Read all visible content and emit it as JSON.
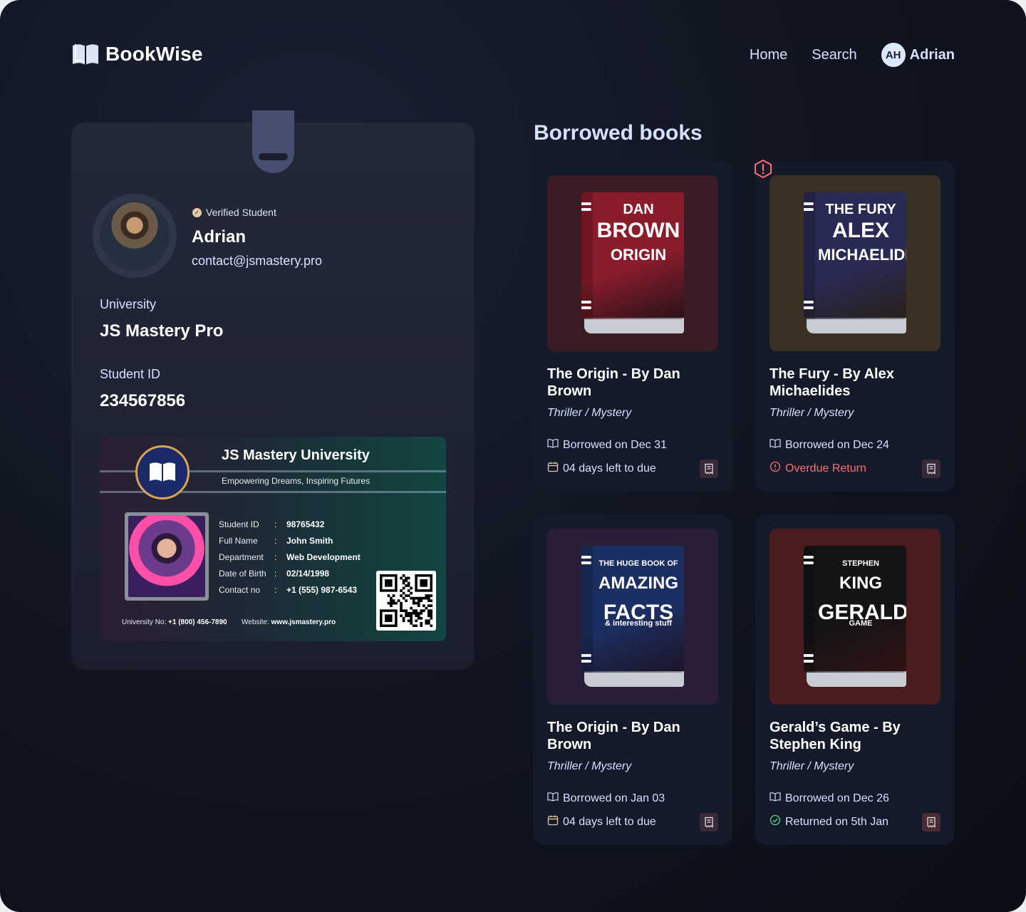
{
  "app": {
    "name": "BookWise"
  },
  "nav": {
    "home": "Home",
    "search": "Search",
    "user_initials": "AH",
    "user_name": "Adrian"
  },
  "profile": {
    "verified_label": "Verified Student",
    "name": "Adrian",
    "email": "contact@jsmastery.pro",
    "university_label": "University",
    "university_value": "JS Mastery Pro",
    "student_id_label": "Student ID",
    "student_id_value": "234567856"
  },
  "university_card": {
    "title": "JS Mastery University",
    "tagline": "Empowering Dreams, Inspiring Futures",
    "fields": [
      {
        "key": "Student ID",
        "value": "98765432"
      },
      {
        "key": "Full Name",
        "value": "John Smith"
      },
      {
        "key": "Department",
        "value": "Web Development"
      },
      {
        "key": "Date of Birth",
        "value": "02/14/1998"
      },
      {
        "key": "Contact no",
        "value": "+1 (555) 987-6543"
      }
    ],
    "footer_phone_label": "University No:",
    "footer_phone": "+1 (800) 456-7890",
    "footer_site_label": "Website:",
    "footer_site": "www.jsmastery.pro"
  },
  "borrowed": {
    "title": "Borrowed books",
    "books": [
      {
        "title": "The Origin - By Dan Brown",
        "genre": "Thriller / Mystery",
        "borrowed": "Borrowed on Dec 31",
        "status": "04 days left to due",
        "status_type": "due",
        "cover_bg": "#3a1d24",
        "cover_color": "#8b1c2c",
        "cover_lines": [
          "DAN",
          "BROWN",
          "ORIGIN"
        ]
      },
      {
        "title": "The Fury - By Alex Michaelides",
        "genre": "Thriller / Mystery",
        "borrowed": "Borrowed on Dec 24",
        "status": "Overdue Return",
        "status_type": "overdue",
        "cover_bg": "#3a3124",
        "cover_color": "#2a2a56",
        "cover_lines": [
          "THE FURY",
          "ALEX",
          "MICHAELIDES"
        ]
      },
      {
        "title": "The Origin - By Dan Brown",
        "genre": "Thriller / Mystery",
        "borrowed": "Borrowed on Jan 03",
        "status": "04 days left to due",
        "status_type": "due",
        "cover_bg": "#2a1e38",
        "cover_color": "#1c2f63",
        "cover_lines": [
          "THE HUGE BOOK OF",
          "AMAZING",
          "FACTS",
          "& interesting stuff"
        ]
      },
      {
        "title": "Gerald’s Game - By Stephen King",
        "genre": "Thriller / Mystery",
        "borrowed": "Borrowed on Dec 26",
        "status": "Returned on 5th Jan",
        "status_type": "returned",
        "cover_bg": "#4a1c1e",
        "cover_color": "#141416",
        "cover_lines": [
          "STEPHEN",
          "KING",
          "GERALD'S",
          "GAME"
        ]
      }
    ]
  },
  "colors": {
    "accent": "#d6e0ff",
    "overdue": "#ff6c6f",
    "returned": "#4ade80",
    "due": "#e7c9a5",
    "receipt_bg": "#3a2a35"
  }
}
